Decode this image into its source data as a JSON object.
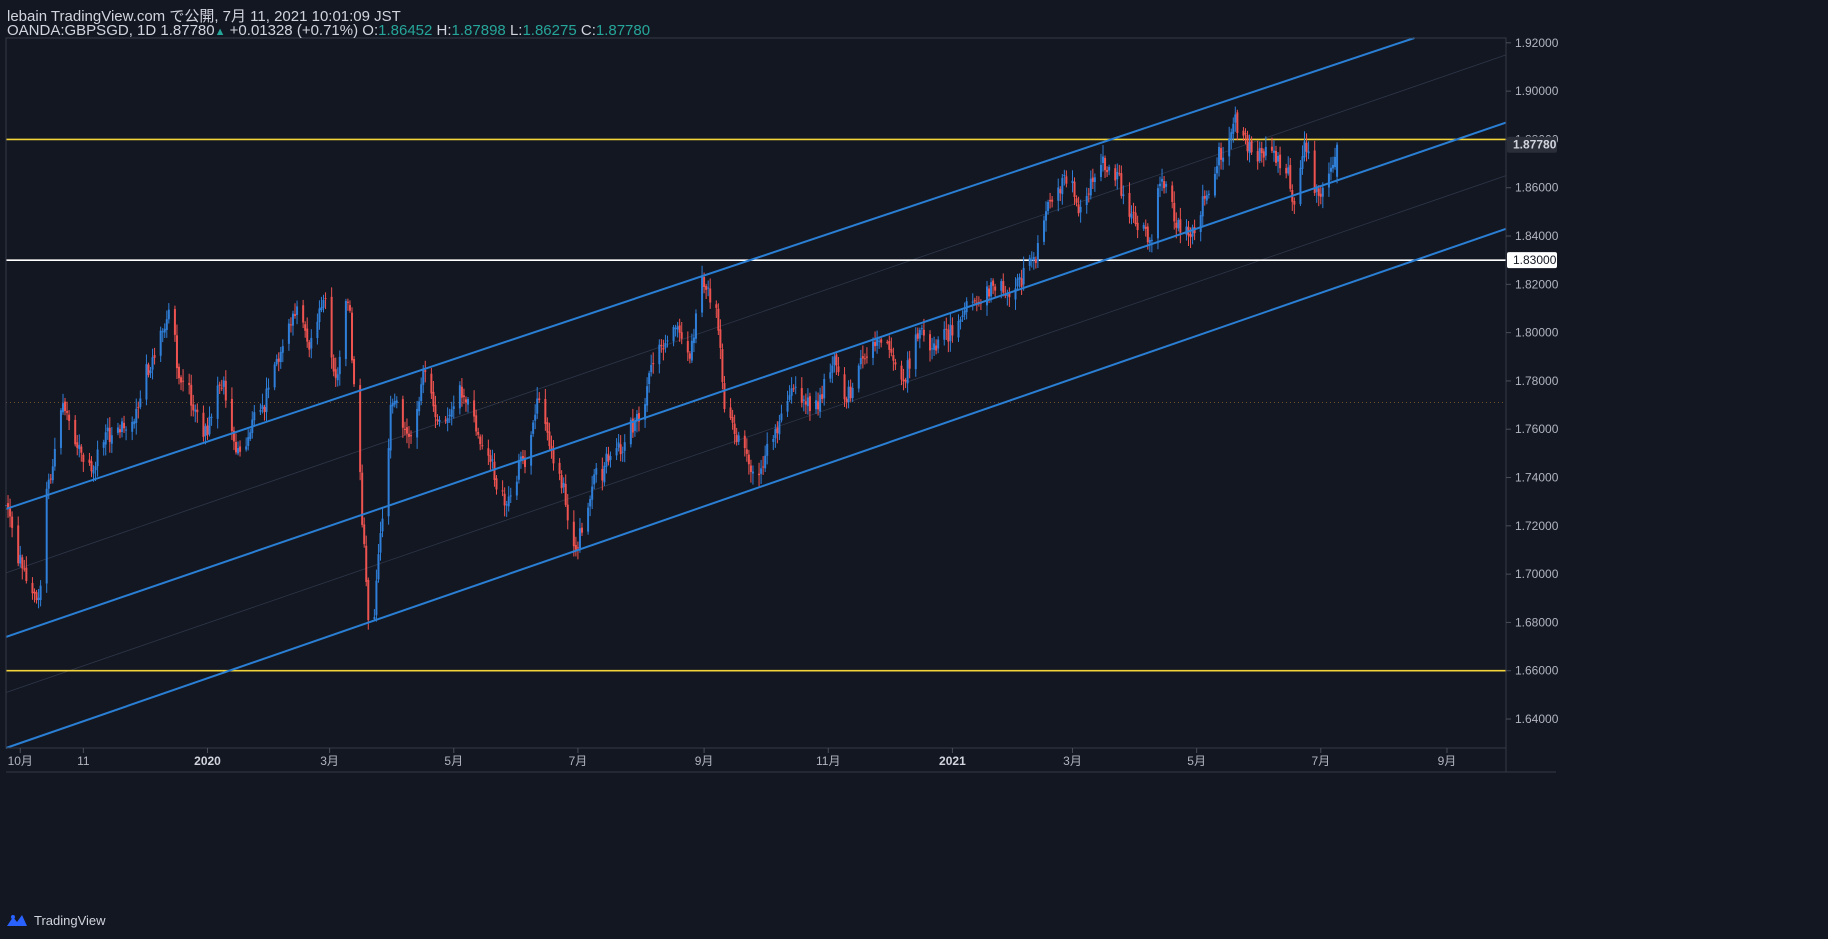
{
  "header": {
    "title": "lebain TradingView.com で公開, 7月 11, 2021 10:01:09 JST",
    "symbol": "OANDA:GBPSGD, 1D",
    "last": "1.87780",
    "change": "+0.01328 (+0.71%)",
    "o_label": "O:",
    "o_value": "1.86452",
    "h_label": "H:",
    "h_value": "1.87898",
    "l_label": "L:",
    "l_value": "1.86275",
    "c_label": "C:",
    "c_value": "1.87780"
  },
  "footer": {
    "brand": "TradingView"
  },
  "colors": {
    "background": "#131722",
    "up": "#2f7fd9",
    "down": "#ef5350",
    "channel": "#2a7fd4",
    "resistance": "#f2d33a",
    "support_white": "#ffffff",
    "text": "#b2b5be"
  },
  "chart_data": {
    "type": "candlestick",
    "symbol": "OANDA:GBPSGD",
    "timeframe": "1D",
    "x_range": [
      "2019-09-24",
      "2021-09-30"
    ],
    "ylim": [
      1.628,
      1.922
    ],
    "y_ticks": [
      "1.92000",
      "1.90000",
      "1.88000",
      "1.86000",
      "1.84000",
      "1.82000",
      "1.80000",
      "1.78000",
      "1.76000",
      "1.74000",
      "1.72000",
      "1.70000",
      "1.68000",
      "1.66000",
      "1.64000"
    ],
    "x_ticks": [
      {
        "label": "10月",
        "date": "2019-10-01",
        "bold": false
      },
      {
        "label": "11",
        "date": "2019-11-01",
        "bold": false
      },
      {
        "label": "2020",
        "date": "2020-01-01",
        "bold": true
      },
      {
        "label": "3月",
        "date": "2020-03-01",
        "bold": false
      },
      {
        "label": "5月",
        "date": "2020-05-01",
        "bold": false
      },
      {
        "label": "7月",
        "date": "2020-07-01",
        "bold": false
      },
      {
        "label": "9月",
        "date": "2020-09-01",
        "bold": false
      },
      {
        "label": "11月",
        "date": "2020-11-01",
        "bold": false
      },
      {
        "label": "2021",
        "date": "2021-01-01",
        "bold": true
      },
      {
        "label": "3月",
        "date": "2021-03-01",
        "bold": false
      },
      {
        "label": "5月",
        "date": "2021-05-01",
        "bold": false
      },
      {
        "label": "7月",
        "date": "2021-07-01",
        "bold": false
      },
      {
        "label": "9月",
        "date": "2021-09-01",
        "bold": false
      }
    ],
    "horizontal_lines": [
      {
        "price": 1.88,
        "color": "#f2d33a",
        "label": "1.88000"
      },
      {
        "price": 1.83,
        "color": "#ffffff",
        "label": "1.83000"
      },
      {
        "price": 1.66,
        "color": "#f2d33a",
        "label": "1.66000"
      }
    ],
    "price_label": {
      "price": 1.8778,
      "label": "1.87780"
    },
    "dotted_price": 1.771,
    "channel": {
      "lines": [
        {
          "start": [
            "2019-09-24",
            1.727
          ],
          "end": [
            "2021-08-16",
            1.922
          ]
        },
        {
          "start": [
            "2019-09-24",
            1.674
          ],
          "end": [
            "2021-09-30",
            1.887
          ]
        },
        {
          "start": [
            "2019-09-24",
            1.628
          ],
          "end": [
            "2021-09-30",
            1.843
          ]
        }
      ],
      "mid_lines": [
        {
          "start": [
            "2019-09-24",
            1.7005
          ],
          "end": [
            "2021-09-30",
            1.915
          ]
        },
        {
          "start": [
            "2019-09-24",
            1.651
          ],
          "end": [
            "2021-09-30",
            1.865
          ]
        }
      ]
    },
    "anchors": [
      [
        "2019-09-24",
        1.725
      ],
      [
        "2019-10-01",
        1.705
      ],
      [
        "2019-10-10",
        1.688
      ],
      [
        "2019-10-15",
        1.74
      ],
      [
        "2019-10-22",
        1.768
      ],
      [
        "2019-10-30",
        1.752
      ],
      [
        "2019-11-05",
        1.745
      ],
      [
        "2019-11-15",
        1.758
      ],
      [
        "2019-11-25",
        1.765
      ],
      [
        "2019-12-05",
        1.788
      ],
      [
        "2019-12-13",
        1.806
      ],
      [
        "2019-12-20",
        1.778
      ],
      [
        "2019-12-31",
        1.76
      ],
      [
        "2020-01-08",
        1.78
      ],
      [
        "2020-01-16",
        1.751
      ],
      [
        "2020-01-27",
        1.768
      ],
      [
        "2020-02-05",
        1.789
      ],
      [
        "2020-02-14",
        1.81
      ],
      [
        "2020-02-21",
        1.795
      ],
      [
        "2020-02-28",
        1.817
      ],
      [
        "2020-03-04",
        1.778
      ],
      [
        "2020-03-10",
        1.812
      ],
      [
        "2020-03-14",
        1.773
      ],
      [
        "2020-03-18",
        1.71
      ],
      [
        "2020-03-21",
        1.67
      ],
      [
        "2020-03-27",
        1.722
      ],
      [
        "2020-04-01",
        1.772
      ],
      [
        "2020-04-09",
        1.76
      ],
      [
        "2020-04-17",
        1.782
      ],
      [
        "2020-04-24",
        1.764
      ],
      [
        "2020-05-05",
        1.776
      ],
      [
        "2020-05-15",
        1.755
      ],
      [
        "2020-05-26",
        1.73
      ],
      [
        "2020-06-05",
        1.748
      ],
      [
        "2020-06-12",
        1.77
      ],
      [
        "2020-06-20",
        1.745
      ],
      [
        "2020-06-30",
        1.714
      ],
      [
        "2020-07-10",
        1.74
      ],
      [
        "2020-07-20",
        1.752
      ],
      [
        "2020-07-31",
        1.764
      ],
      [
        "2020-08-07",
        1.79
      ],
      [
        "2020-08-17",
        1.8
      ],
      [
        "2020-08-25",
        1.793
      ],
      [
        "2020-09-01",
        1.822
      ],
      [
        "2020-09-07",
        1.808
      ],
      [
        "2020-09-11",
        1.772
      ],
      [
        "2020-09-18",
        1.754
      ],
      [
        "2020-09-26",
        1.742
      ],
      [
        "2020-10-06",
        1.76
      ],
      [
        "2020-10-16",
        1.775
      ],
      [
        "2020-10-26",
        1.77
      ],
      [
        "2020-11-03",
        1.788
      ],
      [
        "2020-11-09",
        1.772
      ],
      [
        "2020-11-20",
        1.793
      ],
      [
        "2020-11-30",
        1.796
      ],
      [
        "2020-12-08",
        1.782
      ],
      [
        "2020-12-15",
        1.8
      ],
      [
        "2020-12-22",
        1.796
      ],
      [
        "2020-12-31",
        1.8
      ],
      [
        "2021-01-11",
        1.812
      ],
      [
        "2021-01-22",
        1.82
      ],
      [
        "2021-02-01",
        1.818
      ],
      [
        "2021-02-10",
        1.832
      ],
      [
        "2021-02-20",
        1.855
      ],
      [
        "2021-02-27",
        1.866
      ],
      [
        "2021-03-05",
        1.85
      ],
      [
        "2021-03-15",
        1.872
      ],
      [
        "2021-03-22",
        1.866
      ],
      [
        "2021-03-30",
        1.848
      ],
      [
        "2021-04-08",
        1.84
      ],
      [
        "2021-04-14",
        1.862
      ],
      [
        "2021-04-22",
        1.845
      ],
      [
        "2021-04-29",
        1.84
      ],
      [
        "2021-05-06",
        1.858
      ],
      [
        "2021-05-12",
        1.873
      ],
      [
        "2021-05-20",
        1.887
      ],
      [
        "2021-05-28",
        1.875
      ],
      [
        "2021-06-04",
        1.874
      ],
      [
        "2021-06-14",
        1.868
      ],
      [
        "2021-06-18",
        1.856
      ],
      [
        "2021-06-23",
        1.876
      ],
      [
        "2021-06-29",
        1.857
      ],
      [
        "2021-07-05",
        1.862
      ],
      [
        "2021-07-09",
        1.8778
      ]
    ]
  }
}
